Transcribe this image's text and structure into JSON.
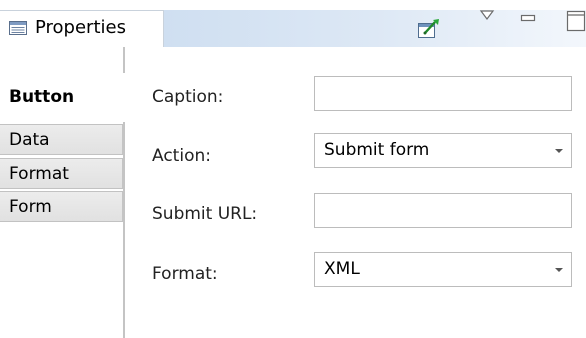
{
  "view": {
    "title": "Properties",
    "icon": "properties-view-icon",
    "toolbar": {
      "pin_icon": "pin-editor-icon",
      "menu_icon": "view-menu-icon",
      "minimize_icon": "minimize-icon",
      "maximize_icon": "maximize-icon"
    }
  },
  "tabs": [
    {
      "label": "Button",
      "active": true
    },
    {
      "label": "Data",
      "active": false
    },
    {
      "label": "Format",
      "active": false
    },
    {
      "label": "Form",
      "active": false
    }
  ],
  "fields": {
    "caption": {
      "label": "Caption:",
      "value": ""
    },
    "action": {
      "label": "Action:",
      "value": "Submit form"
    },
    "submit_url": {
      "label": "Submit URL:",
      "value": ""
    },
    "format": {
      "label": "Format:",
      "value": "XML"
    }
  },
  "colors": {
    "tab_strip_accent": "#cfdff1",
    "inactive_tab": "#e4e4e4",
    "border": "#bcbcbc"
  }
}
